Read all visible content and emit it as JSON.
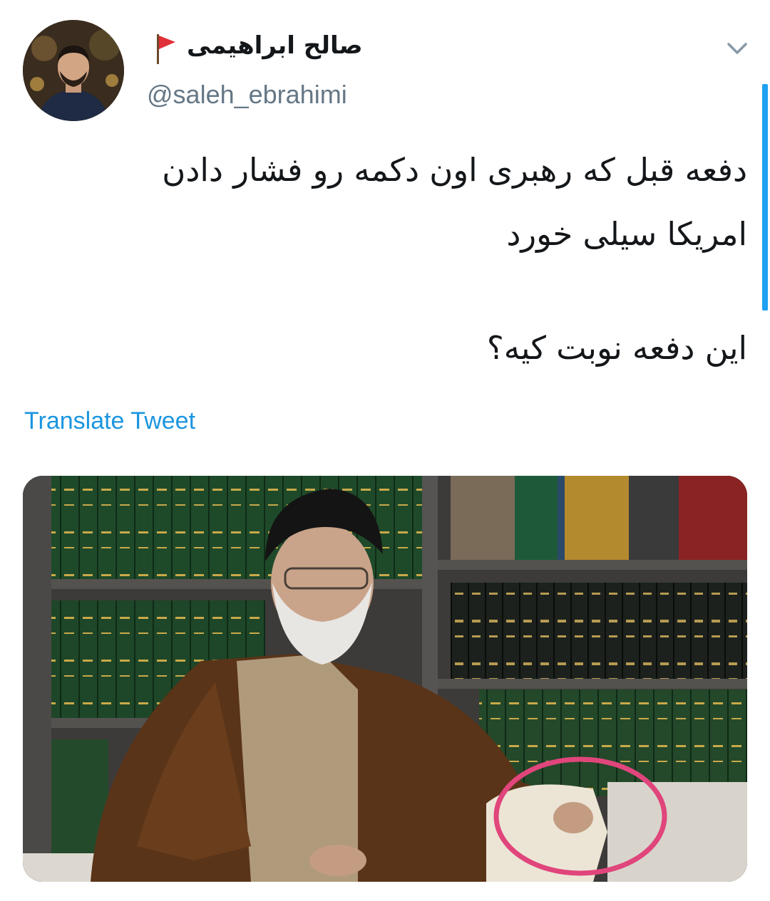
{
  "author": {
    "display_name": "صالح ابراهیمی",
    "handle": "@saleh_ebrahimi"
  },
  "tweet": {
    "line1": "دفعه قبل که رهبری اون دکمه رو فشار دادن",
    "line2": "امریکا سیلی خورد",
    "line3": "این دفعه نوبت کیه؟"
  },
  "translate_label": "Translate Tweet",
  "icons": {
    "flag": "flag-icon",
    "menu": "chevron-down-icon"
  },
  "colors": {
    "link": "#1b95e0",
    "handle": "#657786",
    "highlight_circle": "#e0457b",
    "scroll_indicator": "#1da1f2"
  }
}
